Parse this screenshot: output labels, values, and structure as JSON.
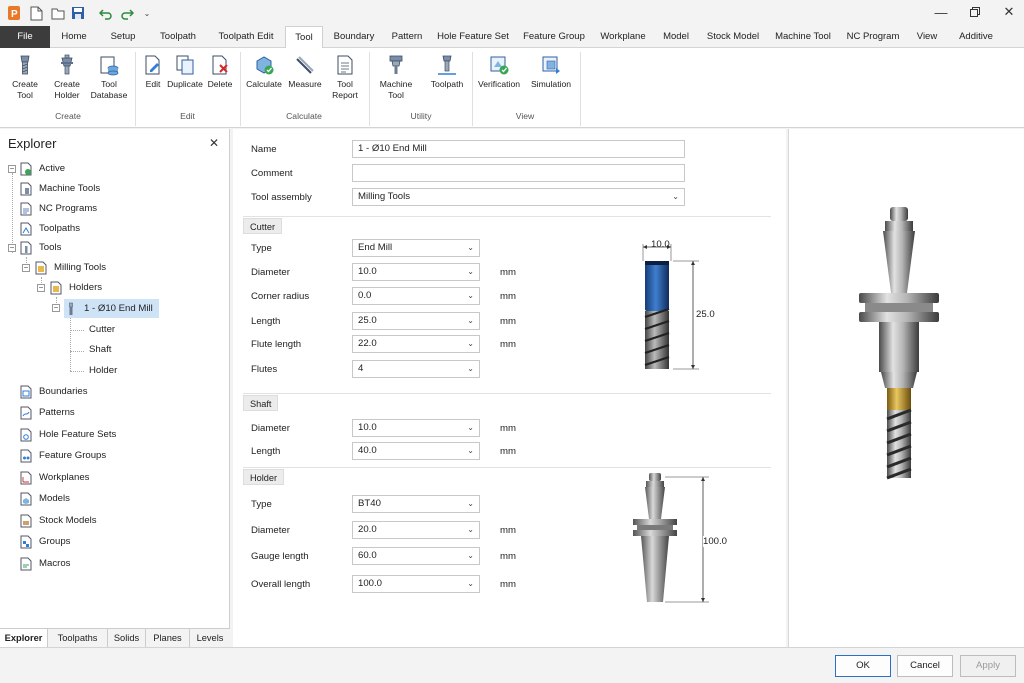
{
  "quick_access": [
    "app-logo-icon",
    "new-file-icon",
    "open-folder-icon",
    "save-icon",
    "undo-icon",
    "redo-icon",
    "chevron-down-icon"
  ],
  "tabs": [
    "File",
    "Home",
    "Setup",
    "Toolpath",
    "Toolpath Edit",
    "Tool",
    "Boundary",
    "Pattern",
    "Hole Feature Set",
    "Feature Group",
    "Workplane",
    "Model",
    "Stock Model",
    "Machine Tool",
    "NC Program",
    "View",
    "Additive"
  ],
  "active_tab": "Tool",
  "ribbon": {
    "create": {
      "label": "Create",
      "buttons": [
        {
          "l1": "Create",
          "l2": "Tool"
        },
        {
          "l1": "Create",
          "l2": "Holder"
        },
        {
          "l1": "Tool",
          "l2": "Database"
        }
      ]
    },
    "edit": {
      "label": "Edit",
      "buttons": [
        "Edit",
        "Duplicate",
        "Delete"
      ]
    },
    "calculate": {
      "label": "Calculate",
      "buttons": [
        {
          "l1": "Calculate",
          "l2": ""
        },
        {
          "l1": "Measure",
          "l2": ""
        },
        {
          "l1": "Tool",
          "l2": "Report"
        }
      ]
    },
    "utility": {
      "label": "Utility",
      "buttons": [
        {
          "l1": "Machine",
          "l2": "Tool"
        },
        {
          "l1": "Toolpath",
          "l2": ""
        }
      ]
    },
    "view": {
      "label": "View",
      "buttons": [
        "Verification",
        "Simulation"
      ]
    }
  },
  "explorer": {
    "title": "Explorer",
    "items": [
      "Active",
      "Machine Tools",
      "NC Programs",
      "Toolpaths",
      "Tools",
      "Milling Tools",
      "Holders",
      "1 - Ø10 End Mill",
      "Cutter",
      "Shaft",
      "Holder",
      "Boundaries",
      "Patterns",
      "Hole Feature Sets",
      "Feature Groups",
      "Workplanes",
      "Models",
      "Stock Models",
      "Groups",
      "Macros"
    ],
    "bottom_tabs": [
      "Explorer",
      "Toolpaths",
      "Solids",
      "Planes",
      "Levels"
    ]
  },
  "form": {
    "name_label": "Name",
    "name_value": "1 - Ø10 End Mill",
    "comment_label": "Comment",
    "comment_value": "",
    "assembly_label": "Tool assembly",
    "assembly_value": "Milling Tools",
    "cutter": {
      "title": "Cutter",
      "type_label": "Type",
      "type_value": "End Mill",
      "diameter_label": "Diameter",
      "diameter_value": "10.0",
      "corner_label": "Corner radius",
      "corner_value": "0.0",
      "length_label": "Length",
      "length_value": "25.0",
      "flute_length_label": "Flute length",
      "flute_length_value": "22.0",
      "flutes_label": "Flutes",
      "flutes_value": "4"
    },
    "shaft": {
      "title": "Shaft",
      "diameter_label": "Diameter",
      "diameter_value": "10.0",
      "length_label": "Length",
      "length_value": "40.0"
    },
    "holder": {
      "title": "Holder",
      "type_label": "Type",
      "type_value": "BT40",
      "diameter_label": "Diameter",
      "diameter_value": "20.0",
      "gauge_label": "Gauge length",
      "gauge_value": "60.0",
      "overall_label": "Overall length",
      "overall_value": "100.0"
    },
    "unit": "mm",
    "cutter_dim_width": "10.0",
    "cutter_dim_length": "25.0",
    "holder_dim_length": "100.0"
  },
  "footer": {
    "ok": "OK",
    "cancel": "Cancel",
    "apply": "Apply"
  }
}
